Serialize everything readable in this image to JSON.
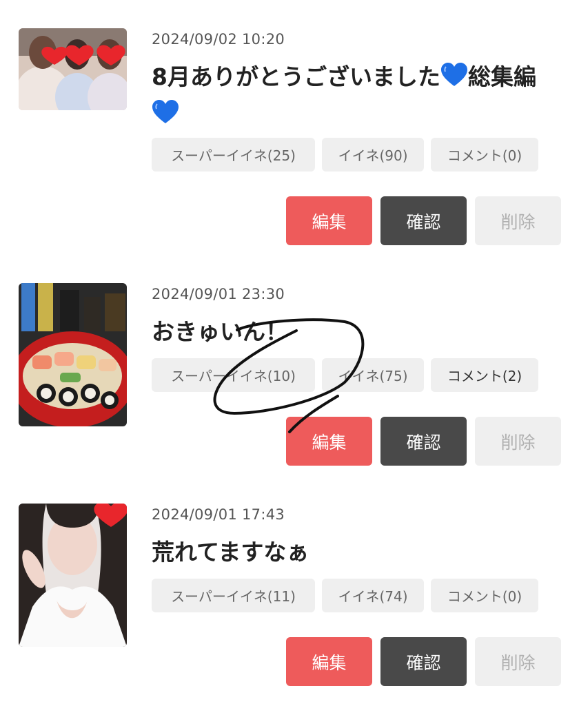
{
  "posts": [
    {
      "date": "2024/09/02 10:20",
      "title_parts": [
        "8月ありがとうございました",
        "総集編"
      ],
      "heart_icon": "blue-heart-icon",
      "super_like": "スーパーイイネ(25)",
      "like": "イイネ(90)",
      "comment": "コメント(0)",
      "thumb_icon": "group-photo-hearts"
    },
    {
      "date": "2024/09/01 23:30",
      "title": "おきゅいん！",
      "super_like": "スーパーイイネ(10)",
      "like": "イイネ(75)",
      "comment": "コメント(2)",
      "thumb_icon": "sushi-photo"
    },
    {
      "date": "2024/09/01 17:43",
      "title": "荒れてますなぁ",
      "super_like": "スーパーイイネ(11)",
      "like": "イイネ(74)",
      "comment": "コメント(0)",
      "thumb_icon": "portrait-heart"
    }
  ],
  "actions": {
    "edit": "編集",
    "confirm": "確認",
    "delete": "削除"
  },
  "colors": {
    "edit": "#ee5b5b",
    "confirm": "#494949",
    "delete_bg": "#efefef",
    "chip_bg": "#efefef",
    "heart_blue": "#1e6fe6"
  }
}
